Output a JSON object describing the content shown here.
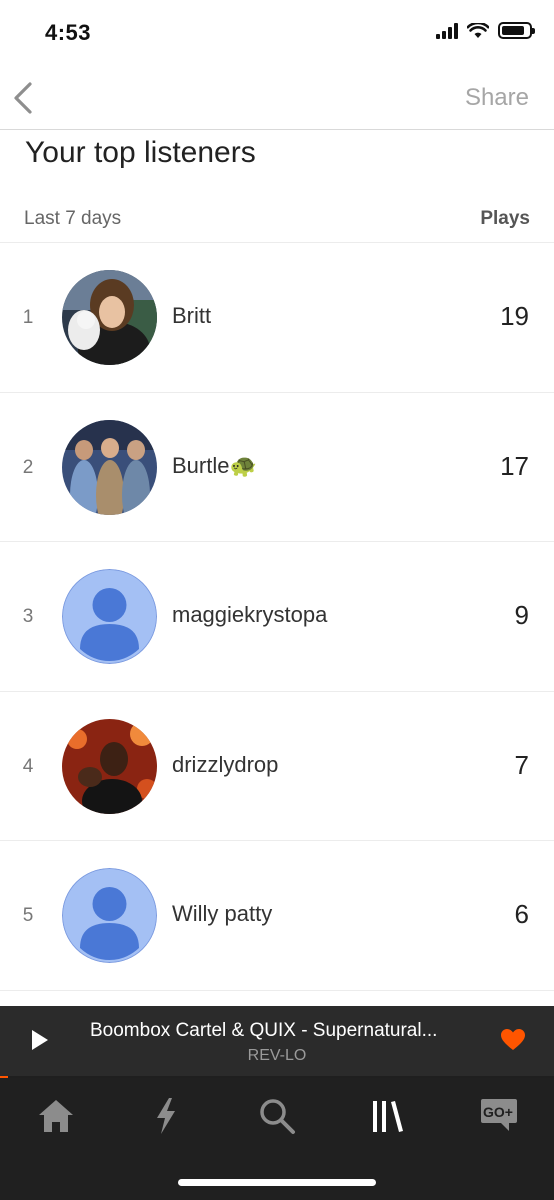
{
  "status_bar": {
    "time": "4:53",
    "battery_level": 0.85
  },
  "nav": {
    "back_icon": "chevron-left-icon",
    "share_label": "Share"
  },
  "page": {
    "title": "Your top listeners"
  },
  "table": {
    "period_label": "Last 7 days",
    "plays_header": "Plays"
  },
  "listeners": [
    {
      "rank": "1",
      "name": "Britt",
      "plays": "19",
      "avatar": "photo"
    },
    {
      "rank": "2",
      "name": "Burtle",
      "emoji": "🐢",
      "plays": "17",
      "avatar": "photo"
    },
    {
      "rank": "3",
      "name": "maggiekrystopa",
      "plays": "9",
      "avatar": "default-user-icon"
    },
    {
      "rank": "4",
      "name": "drizzlydrop",
      "plays": "7",
      "avatar": "photo"
    },
    {
      "rank": "5",
      "name": "Willy patty",
      "plays": "6",
      "avatar": "default-user-icon"
    }
  ],
  "player": {
    "track_title": "Boombox Cartel & QUIX - Supernatural...",
    "artist": "REV-LO",
    "liked": true,
    "progress": 0.015
  },
  "tabs": [
    {
      "name": "home",
      "icon": "home-icon"
    },
    {
      "name": "stream",
      "icon": "lightning-icon"
    },
    {
      "name": "search",
      "icon": "search-icon"
    },
    {
      "name": "library",
      "icon": "library-icon",
      "active": true
    },
    {
      "name": "go-plus",
      "icon": "go-plus-icon",
      "label": "GO+"
    }
  ],
  "colors": {
    "accent": "#ff5500",
    "player_bg": "#2b2b2b",
    "tab_bar_bg": "#202020"
  }
}
